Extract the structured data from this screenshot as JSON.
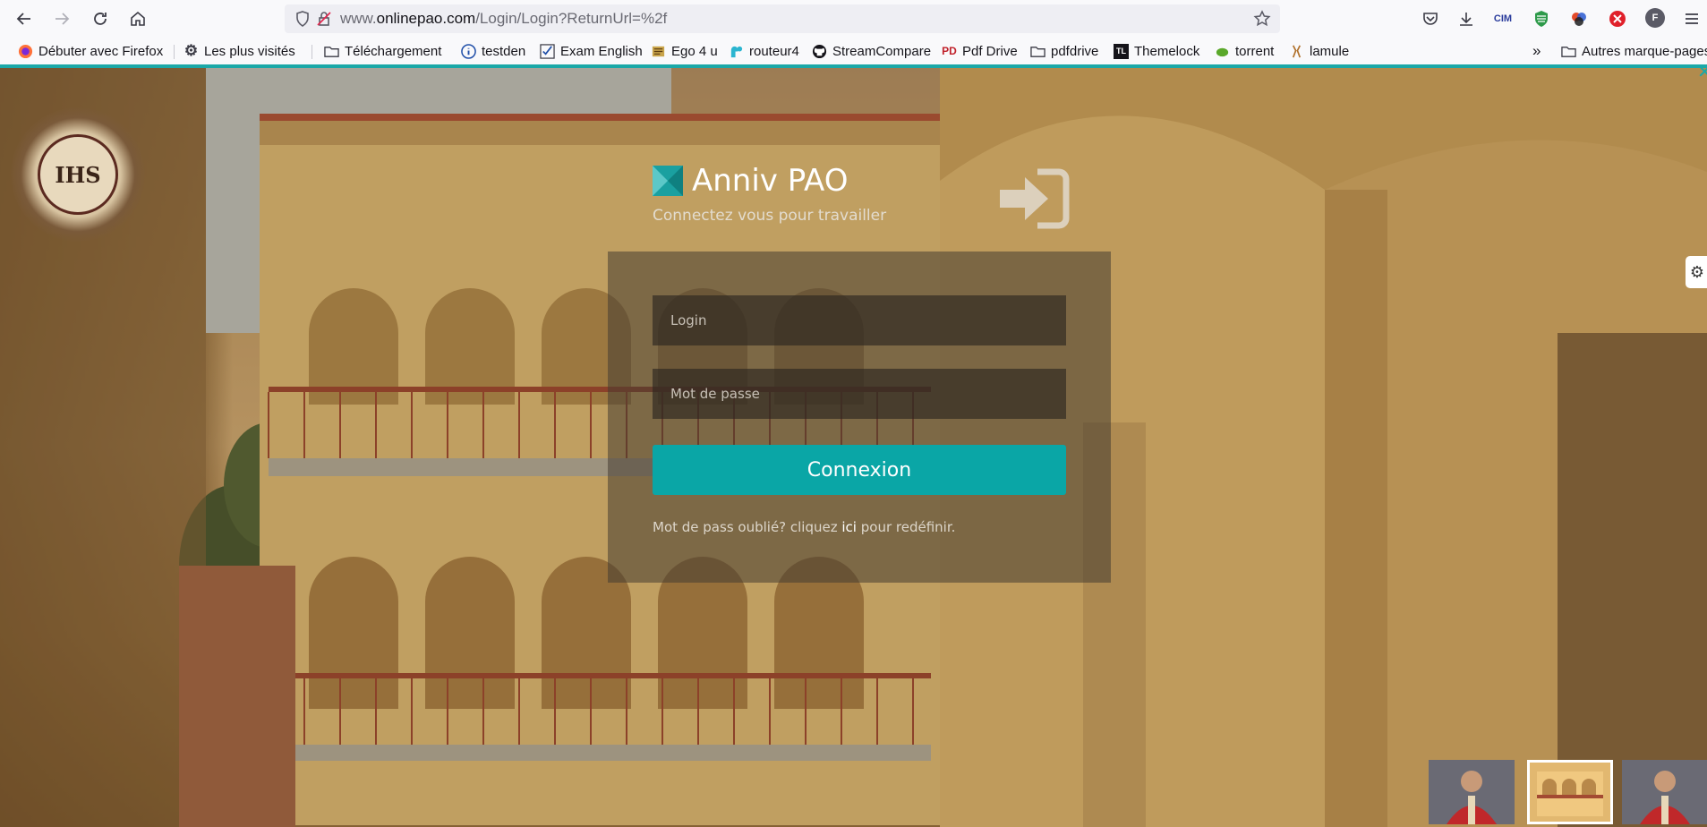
{
  "browser": {
    "url_prefix": "www.",
    "url_domain": "onlinepao.com",
    "url_path": "/Login/Login?ReturnUrl=%2f",
    "extensions": [
      {
        "name": "pocket-icon"
      },
      {
        "name": "download-icon"
      },
      {
        "name": "cim-extension",
        "label": "CIM"
      },
      {
        "name": "shield-extension-icon"
      },
      {
        "name": "multicolor-extension-icon"
      },
      {
        "name": "block-extension-icon"
      },
      {
        "name": "profile-avatar",
        "label": "F"
      },
      {
        "name": "menu-icon"
      }
    ]
  },
  "bookmarks": {
    "items": [
      {
        "label": "Débuter avec Firefox",
        "icon": "firefox-icon"
      },
      {
        "label": "Les plus visités",
        "icon": "gear-icon"
      },
      {
        "label": "Téléchargement",
        "icon": "folder-icon"
      },
      {
        "label": "testden",
        "icon": "info-icon"
      },
      {
        "label": "Exam English",
        "icon": "checkbox-icon"
      },
      {
        "label": "Ego 4 u",
        "icon": "ego-icon"
      },
      {
        "label": "routeur4",
        "icon": "tplink-icon"
      },
      {
        "label": "StreamCompare",
        "icon": "github-icon"
      },
      {
        "label": "Pdf Drive",
        "icon": "pdfdrive-icon"
      },
      {
        "label": "pdfdrive",
        "icon": "folder-icon"
      },
      {
        "label": "Themelock",
        "icon": "themelock-icon"
      },
      {
        "label": "torrent",
        "icon": "torrent-icon"
      },
      {
        "label": "lamule",
        "icon": "lamule-icon"
      }
    ],
    "tl_badge": "TL",
    "pd_badge": "PD",
    "other": "Autres marque-pages"
  },
  "login": {
    "brand_title": "Anniv PAO",
    "brand_subtitle": "Connectez vous pour travailler",
    "login_placeholder": "Login",
    "password_placeholder": "Mot de passe",
    "submit_label": "Connexion",
    "forgot_prefix": "Mot de pass oublié? cliquez ",
    "forgot_link": "ici",
    "forgot_suffix": " pour redéfinir."
  },
  "seal_text": "IHS",
  "colors": {
    "accent": "#0aa6a6"
  }
}
